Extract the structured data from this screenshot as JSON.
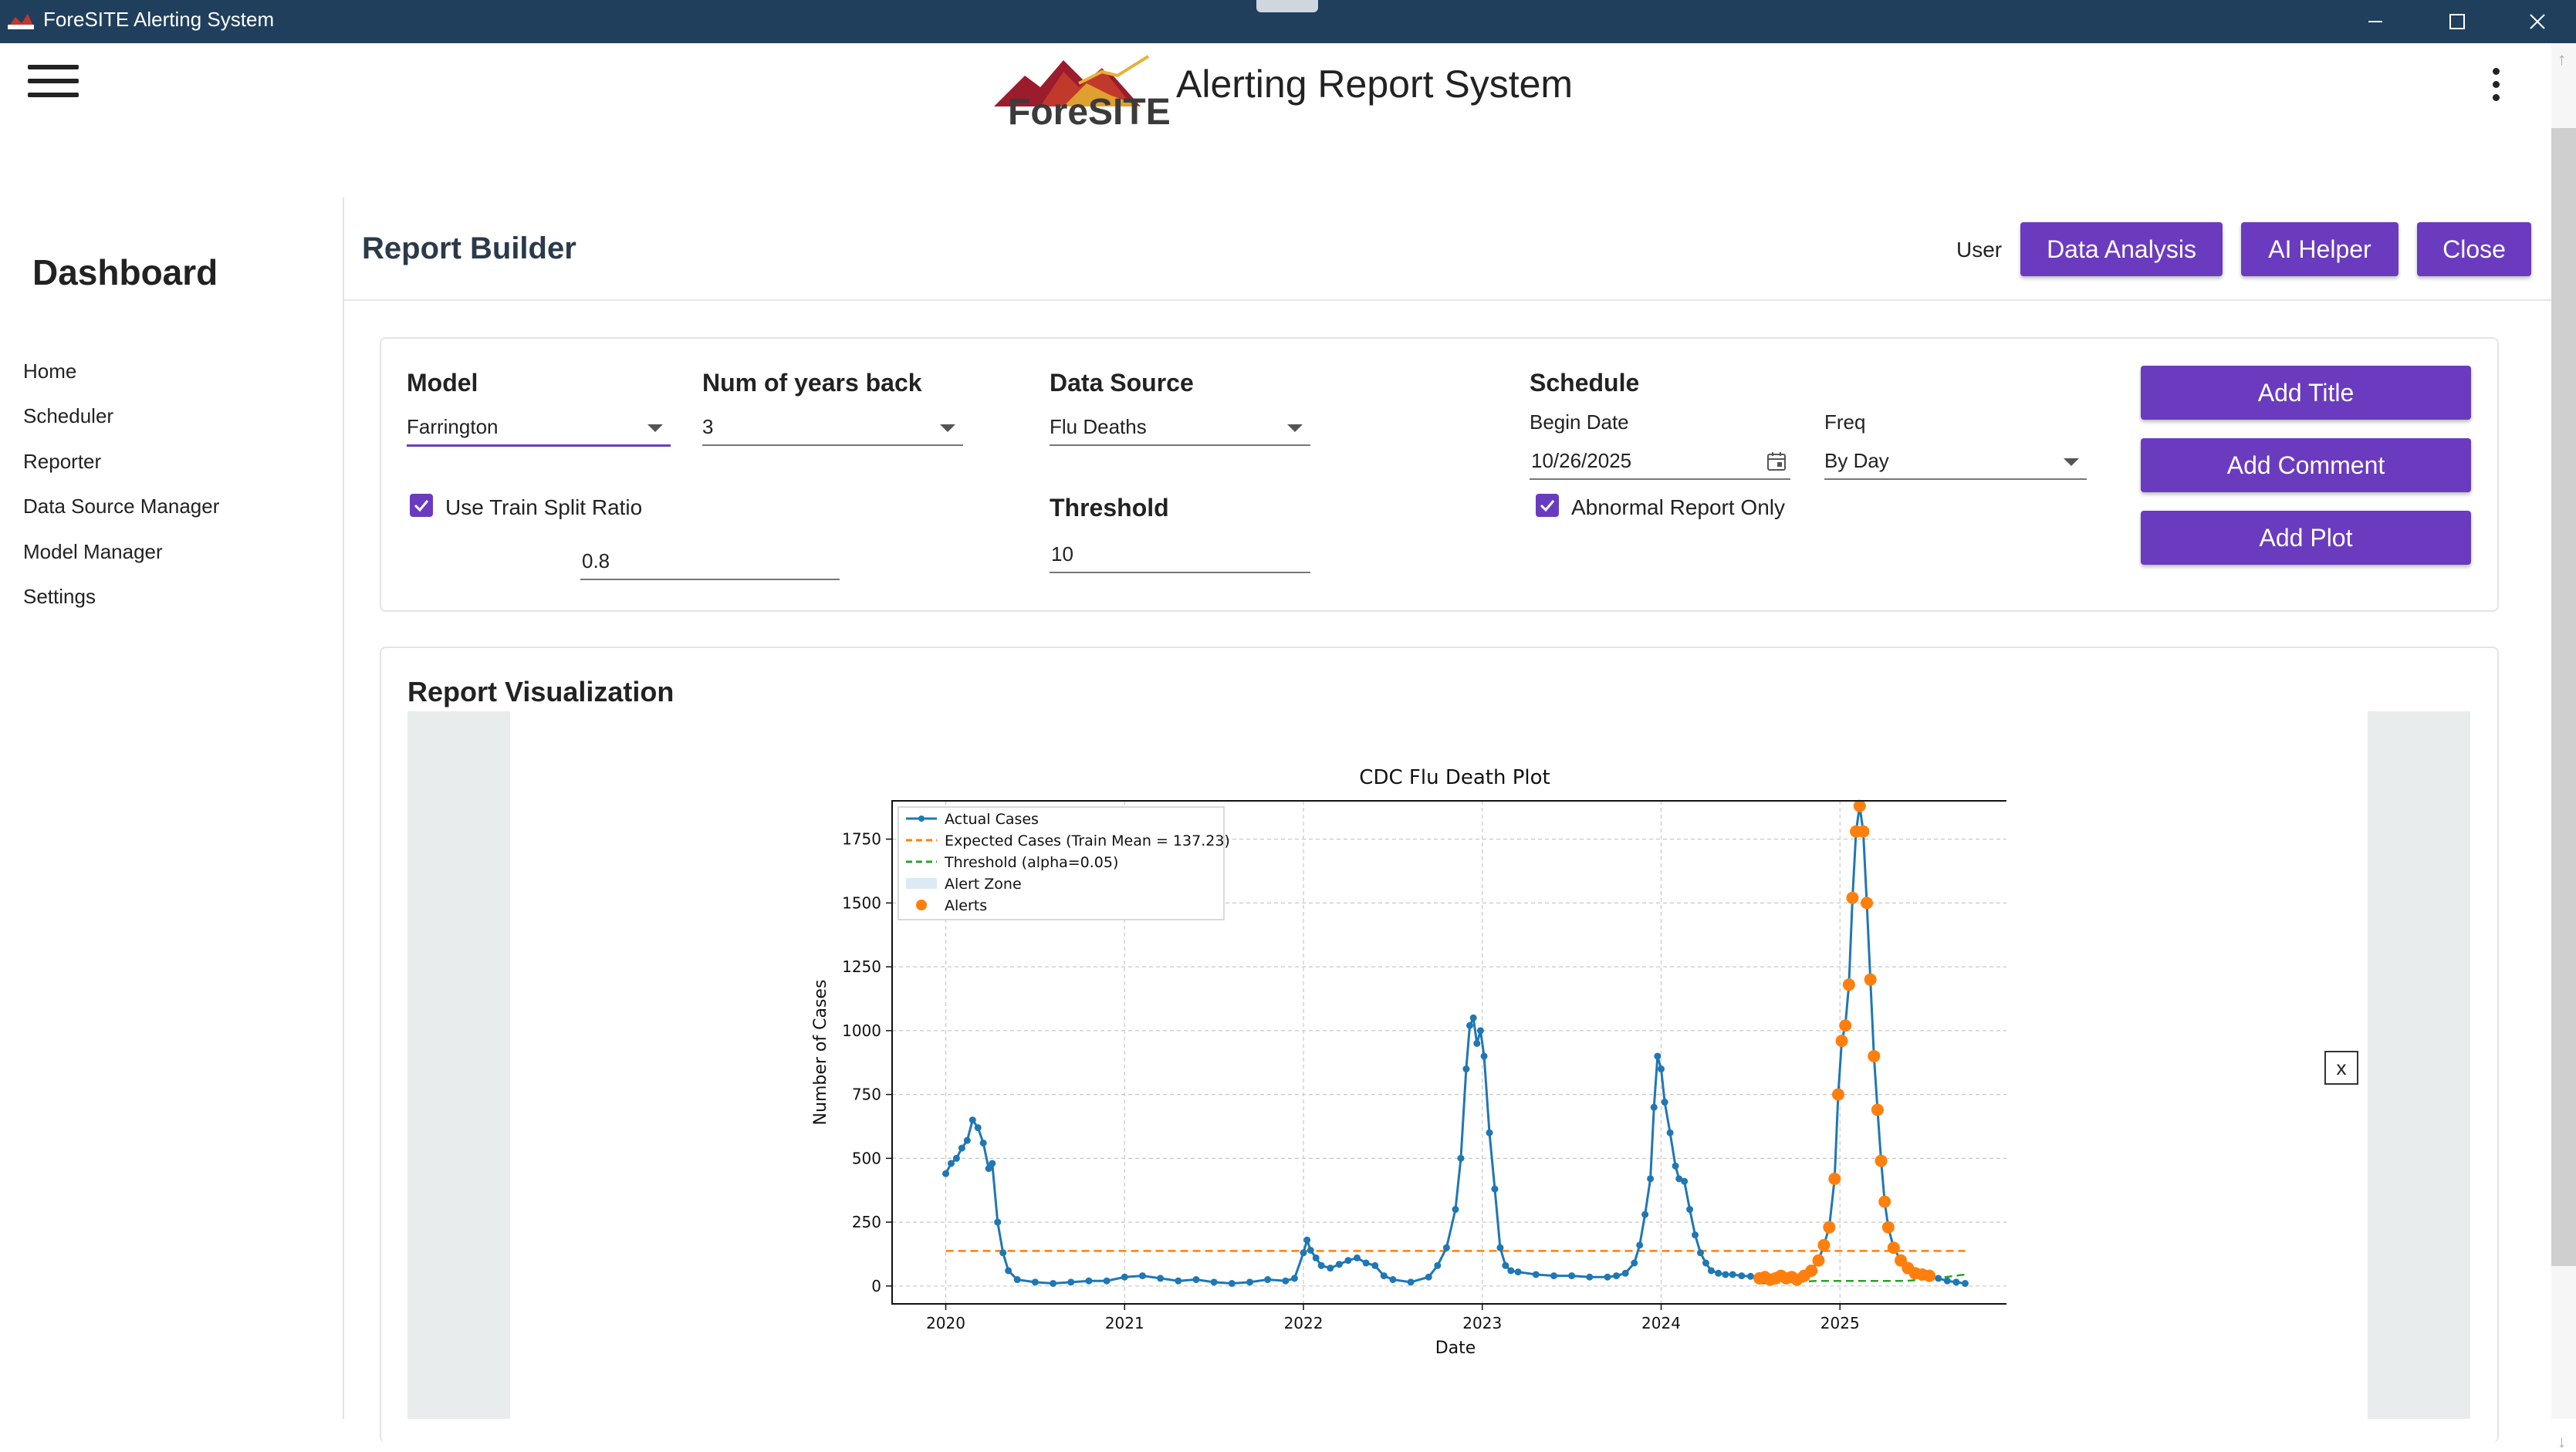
{
  "window": {
    "title": "ForeSITE Alerting System"
  },
  "header": {
    "logo_text": "ForeSITE",
    "app_title": "Alerting Report System"
  },
  "sidebar": {
    "title": "Dashboard",
    "items": [
      {
        "label": "Home"
      },
      {
        "label": "Scheduler"
      },
      {
        "label": "Reporter"
      },
      {
        "label": "Data Source Manager"
      },
      {
        "label": "Model Manager"
      },
      {
        "label": "Settings"
      }
    ]
  },
  "report_builder": {
    "title": "Report Builder",
    "user_label": "User",
    "buttons": {
      "data_analysis": "Data Analysis",
      "ai_helper": "AI Helper",
      "close": "Close"
    }
  },
  "form": {
    "model": {
      "label": "Model",
      "value": "Farrington"
    },
    "years_back": {
      "label": "Num of years back",
      "value": "3"
    },
    "data_source": {
      "label": "Data Source",
      "value": "Flu Deaths"
    },
    "threshold": {
      "label": "Threshold",
      "value": "10"
    },
    "train_split": {
      "label": "Use Train Split Ratio",
      "checked": true,
      "value": "0.8"
    },
    "schedule": {
      "label": "Schedule",
      "begin_date_label": "Begin Date",
      "begin_date": "10/26/2025",
      "freq_label": "Freq",
      "freq": "By Day",
      "abnormal_label": "Abnormal Report Only",
      "abnormal_checked": true
    },
    "actions": {
      "add_title": "Add Title",
      "add_comment": "Add Comment",
      "add_plot": "Add Plot"
    }
  },
  "visualization": {
    "title": "Report Visualization",
    "close_label": "x"
  },
  "colors": {
    "accent": "#6a3bbf",
    "titlebar": "#1f3f5c",
    "actual": "#1f77b4",
    "alert": "#ff7f0e",
    "threshold": "#2ca02c"
  },
  "chart_data": {
    "type": "line",
    "title": "CDC Flu Death Plot",
    "xlabel": "Date",
    "ylabel": "Number of Cases",
    "xlim": [
      2019.7,
      2026.0
    ],
    "ylim": [
      -70,
      1900
    ],
    "x_ticks": [
      2020,
      2021,
      2022,
      2023,
      2024,
      2025
    ],
    "y_ticks": [
      0,
      250,
      500,
      750,
      1000,
      1250,
      1500,
      1750
    ],
    "grid": true,
    "legend_position": "top-left",
    "legend": [
      "Actual Cases",
      "Expected Cases (Train Mean = 137.23)",
      "Threshold (alpha=0.05)",
      "Alert Zone",
      "Alerts"
    ],
    "expected_mean": 137.23,
    "expected_range": [
      2020.0,
      2025.7
    ],
    "threshold_range": [
      2024.55,
      2025.7
    ],
    "threshold_values": [
      10,
      15,
      20,
      20,
      20,
      20,
      30,
      45
    ],
    "series": [
      {
        "name": "Actual Cases",
        "x": [
          2020.0,
          2020.03,
          2020.06,
          2020.09,
          2020.12,
          2020.15,
          2020.18,
          2020.21,
          2020.24,
          2020.26,
          2020.29,
          2020.32,
          2020.35,
          2020.4,
          2020.5,
          2020.6,
          2020.7,
          2020.8,
          2020.9,
          2021.0,
          2021.1,
          2021.2,
          2021.3,
          2021.4,
          2021.5,
          2021.6,
          2021.7,
          2021.8,
          2021.9,
          2021.95,
          2022.0,
          2022.02,
          2022.04,
          2022.07,
          2022.1,
          2022.15,
          2022.2,
          2022.25,
          2022.3,
          2022.35,
          2022.4,
          2022.45,
          2022.5,
          2022.6,
          2022.7,
          2022.75,
          2022.8,
          2022.85,
          2022.88,
          2022.91,
          2022.93,
          2022.95,
          2022.97,
          2022.99,
          2023.01,
          2023.04,
          2023.07,
          2023.1,
          2023.13,
          2023.16,
          2023.2,
          2023.3,
          2023.4,
          2023.5,
          2023.6,
          2023.7,
          2023.75,
          2023.8,
          2023.85,
          2023.88,
          2023.91,
          2023.94,
          2023.96,
          2023.98,
          2024.0,
          2024.02,
          2024.05,
          2024.08,
          2024.1,
          2024.13,
          2024.16,
          2024.19,
          2024.22,
          2024.25,
          2024.28,
          2024.32,
          2024.36,
          2024.4,
          2024.45,
          2024.5,
          2024.55,
          2024.6,
          2024.65,
          2024.7,
          2024.75,
          2024.8,
          2024.84,
          2024.88,
          2024.91,
          2024.94,
          2024.97,
          2024.99,
          2025.01,
          2025.03,
          2025.05,
          2025.07,
          2025.09,
          2025.11,
          2025.13,
          2025.15,
          2025.17,
          2025.19,
          2025.21,
          2025.23,
          2025.25,
          2025.27,
          2025.3,
          2025.34,
          2025.38,
          2025.42,
          2025.46,
          2025.5,
          2025.55,
          2025.6,
          2025.65,
          2025.7
        ],
        "y": [
          440,
          480,
          500,
          540,
          570,
          650,
          620,
          560,
          460,
          480,
          250,
          130,
          60,
          25,
          15,
          10,
          15,
          20,
          20,
          35,
          40,
          30,
          20,
          25,
          15,
          10,
          15,
          25,
          20,
          30,
          130,
          180,
          140,
          110,
          80,
          70,
          85,
          100,
          110,
          90,
          80,
          40,
          25,
          15,
          35,
          80,
          150,
          300,
          500,
          850,
          1020,
          1050,
          950,
          1000,
          900,
          600,
          380,
          150,
          80,
          60,
          55,
          45,
          40,
          40,
          35,
          35,
          40,
          50,
          90,
          160,
          280,
          420,
          700,
          900,
          850,
          720,
          600,
          470,
          420,
          410,
          300,
          200,
          130,
          90,
          60,
          50,
          45,
          45,
          40,
          38,
          35,
          30,
          30,
          35,
          30,
          40,
          60,
          100,
          160,
          230,
          420,
          750,
          960,
          1020,
          1180,
          1520,
          1780,
          1880,
          1780,
          1500,
          1200,
          900,
          690,
          490,
          330,
          230,
          150,
          100,
          70,
          50,
          45,
          40,
          30,
          20,
          15,
          10
        ]
      }
    ],
    "alerts": {
      "x": [
        2024.55,
        2024.58,
        2024.61,
        2024.64,
        2024.67,
        2024.7,
        2024.73,
        2024.76,
        2024.8,
        2024.84,
        2024.88,
        2024.91,
        2024.94,
        2024.97,
        2024.99,
        2025.01,
        2025.03,
        2025.05,
        2025.07,
        2025.09,
        2025.11,
        2025.13,
        2025.15,
        2025.17,
        2025.19,
        2025.21,
        2025.23,
        2025.25,
        2025.27,
        2025.3,
        2025.34,
        2025.38,
        2025.42,
        2025.46,
        2025.5
      ],
      "y": [
        30,
        35,
        25,
        30,
        40,
        30,
        35,
        25,
        40,
        60,
        100,
        160,
        230,
        420,
        750,
        960,
        1020,
        1180,
        1520,
        1780,
        1880,
        1780,
        1500,
        1200,
        900,
        690,
        490,
        330,
        230,
        150,
        100,
        70,
        50,
        45,
        40
      ]
    }
  }
}
